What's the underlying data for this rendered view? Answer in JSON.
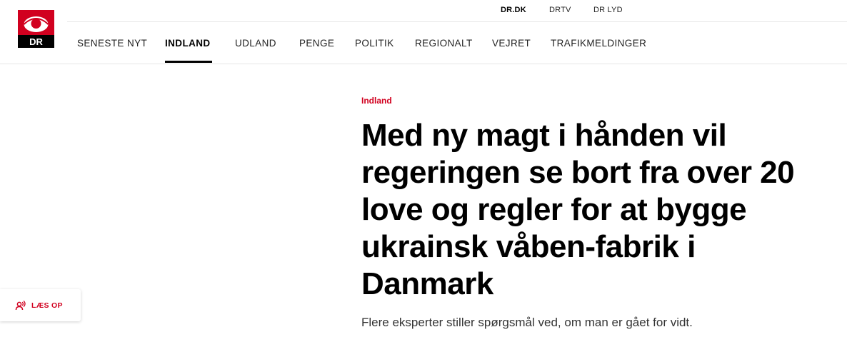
{
  "brand": {
    "logo_text": "DR",
    "color": "#d1001f"
  },
  "top_links": [
    {
      "label": "DR.DK",
      "active": true
    },
    {
      "label": "DRTV",
      "active": false
    },
    {
      "label": "DR LYD",
      "active": false
    }
  ],
  "nav": [
    {
      "label": "SENESTE NYT",
      "active": false
    },
    {
      "label": "INDLAND",
      "active": true
    },
    {
      "label": "UDLAND",
      "active": false
    },
    {
      "label": "PENGE",
      "active": false
    },
    {
      "label": "POLITIK",
      "active": false
    },
    {
      "label": "REGIONALT",
      "active": false
    },
    {
      "label": "VEJRET",
      "active": false
    },
    {
      "label": "TRAFIKMELDINGER",
      "active": false
    }
  ],
  "article": {
    "kicker": "Indland",
    "headline": "Med ny magt i hånden vil regeringen se bort fra over 20 love og regler for at bygge ukrainsk våben-fabrik i Danmark",
    "summary": "Flere eksperter stiller spørgsmål ved, om man er gået for vidt."
  },
  "read_aloud": {
    "label": "LÆS OP",
    "icon": "read-aloud-icon"
  }
}
